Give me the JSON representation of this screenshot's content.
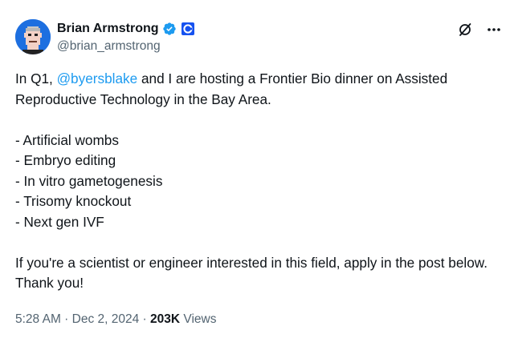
{
  "author": {
    "display_name": "Brian Armstrong",
    "handle": "@brian_armstrong",
    "verified_color": "#1d9bf0",
    "affiliation_color": "#1652f0"
  },
  "icons": {
    "avatar": "avatar-image",
    "verified": "verified-badge-icon",
    "affiliation": "coinbase-logo-icon",
    "grok": "grok-icon",
    "more": "more-options-icon"
  },
  "post": {
    "line1_prefix": "In Q1, ",
    "mention": "@byersblake",
    "line1_suffix": " and I are hosting a Frontier Bio dinner on Assisted Reproductive Technology in the Bay Area.",
    "list": [
      "- Artificial wombs",
      "- Embryo editing",
      "- In vitro gametogenesis",
      "- Trisomy knockout",
      "- Next gen IVF"
    ],
    "closing": "If you're a scientist or engineer interested in this field, apply in the post below. Thank you!"
  },
  "meta": {
    "time": "5:28 AM",
    "separator": " · ",
    "date": "Dec 2, 2024",
    "views_count": "203K",
    "views_label": " Views"
  },
  "colors": {
    "text": "#0f1419",
    "secondary": "#536471",
    "link": "#1d9bf0"
  }
}
